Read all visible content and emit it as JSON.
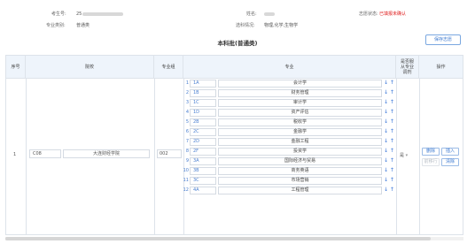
{
  "info": {
    "candidate_no_label": "考生号:",
    "candidate_no_value": "25",
    "name_label": "姓名:",
    "name_value": "",
    "status_label": "志愿状态:",
    "status_value": "已填报未确认",
    "category_label": "专业类别:",
    "category_value": "普通类",
    "subjects_label": "选科情况:",
    "subjects_value": "物理,化学,生物学"
  },
  "page_title": "本科批(普通类)",
  "save_button": "保存志愿",
  "table": {
    "headers": {
      "seq": "序号",
      "school": "院校",
      "group": "专业组",
      "major": "专业",
      "adjust": "是否服从专业调剂",
      "ops": "操作"
    },
    "row": {
      "seq": "1",
      "school_code": "C08",
      "school_name": "大连财经学院",
      "group_code": "002",
      "adjust_value": "是",
      "adjust_arrow": "▾"
    },
    "majors": [
      {
        "seq": "1",
        "code": "1A",
        "name": "会计学",
        "arrows": "↓ ↑"
      },
      {
        "seq": "2",
        "code": "1B",
        "name": "财务管理",
        "arrows": "↓ ↑"
      },
      {
        "seq": "3",
        "code": "1C",
        "name": "审计学",
        "arrows": "↓ ↑"
      },
      {
        "seq": "4",
        "code": "1D",
        "name": "资产评估",
        "arrows": "↓ ↑"
      },
      {
        "seq": "5",
        "code": "2B",
        "name": "税收学",
        "arrows": "↓ ↑"
      },
      {
        "seq": "6",
        "code": "2C",
        "name": "金融学",
        "arrows": "↓ ↑"
      },
      {
        "seq": "7",
        "code": "2D",
        "name": "金融工程",
        "arrows": "↓ ↑"
      },
      {
        "seq": "8",
        "code": "2F",
        "name": "投资学",
        "arrows": "↓ ↑"
      },
      {
        "seq": "9",
        "code": "3A",
        "name": "国际经济与贸易",
        "arrows": "↓ ↑"
      },
      {
        "seq": "10",
        "code": "3B",
        "name": "商务英语",
        "arrows": "↓ ↑"
      },
      {
        "seq": "11",
        "code": "3C",
        "name": "市场营销",
        "arrows": "↓ ↑"
      },
      {
        "seq": "12",
        "code": "4A",
        "name": "工程管理",
        "arrows": "↓ ↑"
      }
    ],
    "ops": {
      "delete": "删除",
      "insert": "插入",
      "move_up": "前移行",
      "clear": "清除"
    }
  }
}
